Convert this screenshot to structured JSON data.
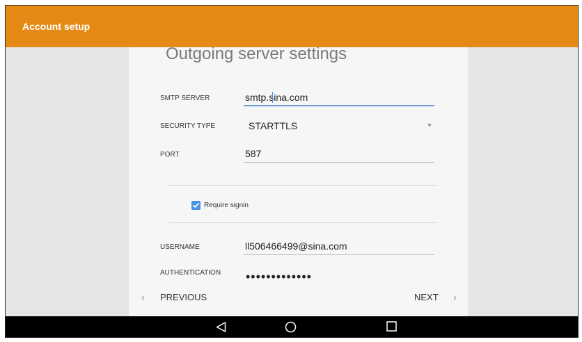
{
  "appbar": {
    "title": "Account setup"
  },
  "form": {
    "title": "Outgoing server settings",
    "smtp_server": {
      "label": "SMTP SERVER",
      "value": "smtp.sina.com"
    },
    "security_type": {
      "label": "SECURITY TYPE",
      "value": "STARTTLS"
    },
    "port": {
      "label": "PORT",
      "value": "587"
    },
    "require_signin": {
      "label": "Require signin",
      "checked": true
    },
    "username": {
      "label": "USERNAME",
      "value": "ll506466499@sina.com"
    },
    "authentication": {
      "label": "AUTHENTICATION",
      "value": "•••••••••••••"
    }
  },
  "nav": {
    "previous": "PREVIOUS",
    "next": "NEXT"
  },
  "system_nav": {
    "icons": [
      "back-icon",
      "home-icon",
      "recents-icon"
    ]
  },
  "colors": {
    "appbar": "#e58a14",
    "accent": "#4a90e2"
  }
}
